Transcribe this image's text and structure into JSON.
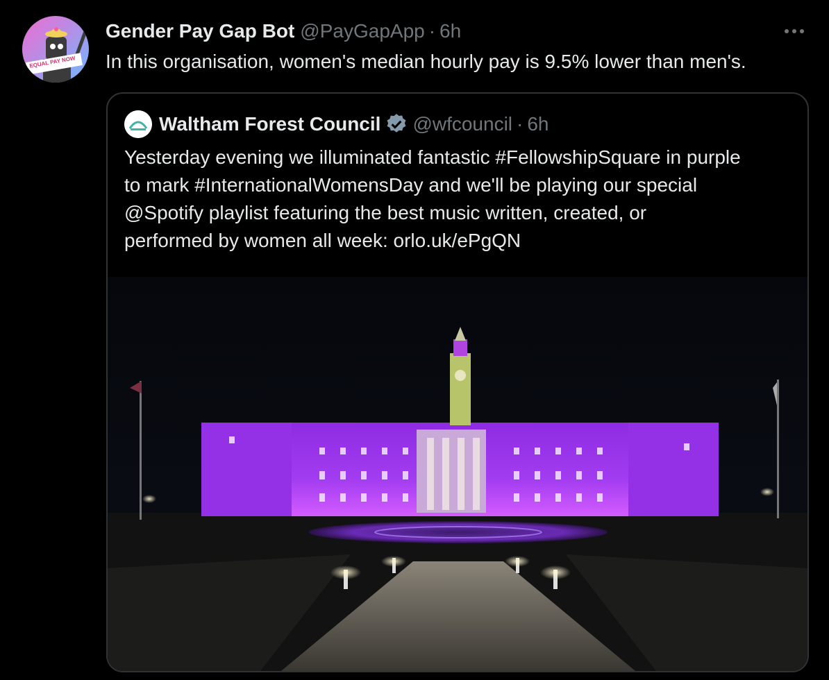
{
  "tweet": {
    "author_name": "Gender Pay Gap Bot",
    "author_handle": "@PayGapApp",
    "separator": "·",
    "time": "6h",
    "avatar_sign_text": "EQUAL PAY NOW",
    "text": "In this organisation, women's median hourly pay is 9.5% lower than men's.",
    "more_icon": "more-horizontal-icon"
  },
  "quoted_tweet": {
    "author_name": "Waltham Forest Council",
    "verified_icon": "verified-badge-icon",
    "author_handle": "@wfcouncil",
    "separator": "·",
    "time": "6h",
    "text_lines": [
      "Yesterday evening we illuminated fantastic #FellowshipSquare in purple",
      "to mark #InternationalWomensDay and we'll be playing our special",
      "@Spotify playlist featuring the best music written, created, or",
      "performed by women all week: orlo.uk/ePgQN"
    ],
    "media_alt": "photo"
  },
  "colors": {
    "background": "#000000",
    "text_primary": "#e7e9ea",
    "text_secondary": "#71767b",
    "border": "#2f3336",
    "verified": "#829aab",
    "building_purple": "#a020f0",
    "tower_green": "#b7c46a"
  }
}
